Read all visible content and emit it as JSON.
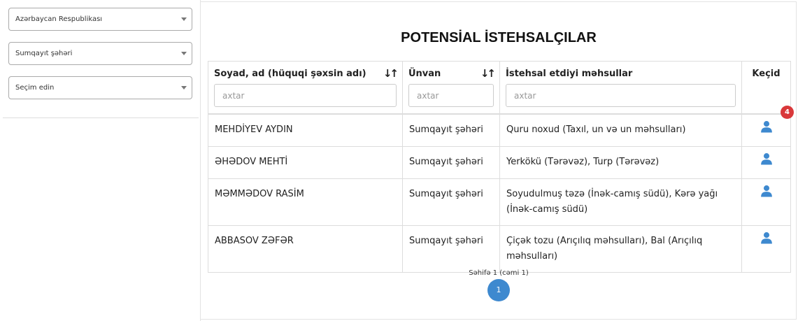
{
  "filters": [
    {
      "value": "Azərbaycan Respublikası"
    },
    {
      "value": "Sumqayıt şəhəri"
    },
    {
      "value": "Seçim edin"
    }
  ],
  "title": "POTENSİAL İSTEHSALÇILAR",
  "columns": {
    "name": "Soyad, ad (hüquqi şəxsin adı)",
    "address": "Ünvan",
    "products": "İstehsal etdiyi məhsullar",
    "link": "Keçid"
  },
  "search_placeholder": "axtar",
  "notification_count": "4",
  "rows": [
    {
      "name": "MEHDİYEV AYDIN",
      "address": "Sumqayıt şəhəri",
      "products": "Quru noxud (Taxıl, un və un məhsulları)"
    },
    {
      "name": "ƏHƏDOV MEHTİ",
      "address": "Sumqayıt şəhəri",
      "products": "Yerkökü (Tərəvəz), Turp (Tərəvəz)"
    },
    {
      "name": "MƏMMƏDOV RASİM",
      "address": "Sumqayıt şəhəri",
      "products": "Soyudulmuş təzə (İnək-camış südü), Kərə yağı (İnək-camış südü)"
    },
    {
      "name": "ABBASOV ZƏFƏR",
      "address": "Sumqayıt şəhəri",
      "products": "Çiçək tozu (Arıçılıq məhsulları), Bal (Arıçılıq məhsulları)"
    }
  ],
  "pagination": {
    "text": "Səhifə 1 (cəmi 1)",
    "current": "1"
  },
  "colors": {
    "accent": "#3e89cf",
    "badge": "#d9383a"
  }
}
